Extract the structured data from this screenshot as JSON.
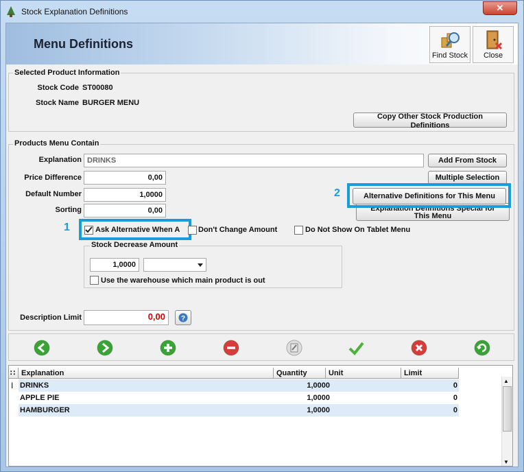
{
  "window": {
    "title": "Stock Explanation Definitions",
    "close_glyph": "✕"
  },
  "header": {
    "title": "Menu Definitions"
  },
  "toolbar": {
    "find_stock_label": "Find Stock",
    "close_label": "Close"
  },
  "selected_product": {
    "group_label": "Selected Product Information",
    "stock_code_label": "Stock Code",
    "stock_code": "ST00080",
    "stock_name_label": "Stock Name",
    "stock_name": "BURGER MENU",
    "copy_button_line1": "Copy Other Stock Production",
    "copy_button_line2": "Definitions"
  },
  "menu_contain": {
    "group_label": "Products Menu Contain",
    "explanation_label": "Explanation",
    "explanation_value": "DRINKS",
    "price_difference_label": "Price Difference",
    "price_difference_value": "0,00",
    "default_number_label": "Default Number",
    "default_number_value": "1,0000",
    "sorting_label": "Sorting",
    "sorting_value": "0,00",
    "add_from_stock_label": "Add From Stock",
    "multiple_selection_label": "Multiple Selection",
    "alternative_definitions_label": "Alternative Definitions for This Menu",
    "explanation_special_line1": "Explanation Definitions Special for",
    "explanation_special_line2": "This Menu",
    "ask_alternative_label": "Ask Alternative When A",
    "ask_alternative_checked": true,
    "dont_change_amount_label": "Don't Change Amount",
    "do_not_show_tablet_label": "Do Not Show On Tablet Menu",
    "stock_decrease_label": "Stock Decrease Amount",
    "stock_decrease_value": "1,0000",
    "unit_select_value": "",
    "use_warehouse_label": "Use the warehouse which main product is out",
    "description_limit_label": "Description Limit",
    "description_limit_value": "0,00",
    "callout_1": "1",
    "callout_2": "2"
  },
  "nav_buttons": [
    {
      "name": "back-icon",
      "color": "#3aa336"
    },
    {
      "name": "forward-icon",
      "color": "#3aa336"
    },
    {
      "name": "add-icon",
      "color": "#3aa336"
    },
    {
      "name": "remove-icon",
      "color": "#d93a3a"
    },
    {
      "name": "edit-icon",
      "color": "#b5b5b5"
    },
    {
      "name": "confirm-icon",
      "color": "#4bb33a"
    },
    {
      "name": "cancel-icon",
      "color": "#d93a3a"
    },
    {
      "name": "refresh-icon",
      "color": "#3aa336"
    }
  ],
  "grid": {
    "headers": [
      "Explanation",
      "Quantity",
      "Unit",
      "Limit"
    ],
    "rows": [
      {
        "explanation": "DRINKS",
        "quantity": "1,0000",
        "unit": "",
        "limit": "0"
      },
      {
        "explanation": "APPLE PIE",
        "quantity": "1,0000",
        "unit": "",
        "limit": "0"
      },
      {
        "explanation": "HAMBURGER",
        "quantity": "1,0000",
        "unit": "",
        "limit": "0"
      }
    ]
  }
}
